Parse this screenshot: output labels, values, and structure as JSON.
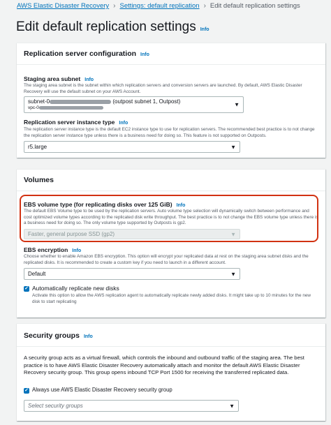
{
  "breadcrumb": {
    "items": [
      "AWS Elastic Disaster Recovery",
      "Settings: default replication"
    ],
    "current": "Edit default replication settings"
  },
  "page": {
    "title": "Edit default replication settings",
    "info": "Info"
  },
  "replication_server": {
    "header": "Replication server configuration",
    "info": "Info",
    "subnet": {
      "label": "Staging area subnet",
      "info": "Info",
      "description": "The staging area subnet is the subnet within which replication servers and conversion servers are launched. By default, AWS Elastic Disaster Recovery will use the default subnet on your AWS Account.",
      "value_prefix": "subnet-0",
      "value_suffix": "(outpost subnet 1, Outpost)",
      "vpc_prefix": "vpc-0"
    },
    "instance_type": {
      "label": "Replication server instance type",
      "info": "Info",
      "description": "The replication server instance type is the default EC2 instance type to use for replication servers. The recommended best practice is to not change the replication server instance type unless there is a business need for doing so. This feature is not supported on Outposts.",
      "value": "r5.large"
    }
  },
  "volumes": {
    "header": "Volumes",
    "ebs_type": {
      "label": "EBS volume type (for replicating disks over 125 GiB)",
      "info": "Info",
      "description": "The default EBS Volume type to be used by the replication servers. Auto volume type selection will dynamically switch between performance and cost optimized volume types according to the replicated disk write throughput. The best practice is to not change the EBS volume type unless there is a business need for doing so. The only volume type supported by Outposts is gp2.",
      "value": "Faster, general purpose SSD (gp2)"
    },
    "encryption": {
      "label": "EBS encryption",
      "info": "Info",
      "description": "Choose whether to enable Amazon EBS encryption. This option will encrypt your replicated data at rest on the staging area subnet disks and the replicated disks. It is recommended to create a custom key if you need to launch in a different account.",
      "value": "Default"
    },
    "auto_replicate": {
      "label": "Automatically replicate new disks",
      "description": "Activate this option to allow the AWS replication agent to automatically replicate newly added disks. It might take up to 10 minutes for the new disk to start replicating",
      "checked": true
    }
  },
  "security_groups": {
    "header": "Security groups",
    "info": "Info",
    "description": "A security group acts as a virtual firewall, which controls the inbound and outbound traffic of the staging area. The best practice is to have AWS Elastic Disaster Recovery automatically attach and monitor the default AWS Elastic Disaster Recovery security group. This group opens inbound TCP Port 1500 for receiving the transferred replicated data.",
    "always_use_label": "Always use AWS Elastic Disaster Recovery security group",
    "always_use_checked": true,
    "select_placeholder": "Select security groups"
  },
  "colors": {
    "link": "#0073bb",
    "highlight": "#d13212",
    "checkbox": "#0073bb"
  },
  "icons": {
    "caret": "caret-down-icon",
    "breadcrumb_sep": "chevron-right-icon",
    "check": "check-icon"
  }
}
